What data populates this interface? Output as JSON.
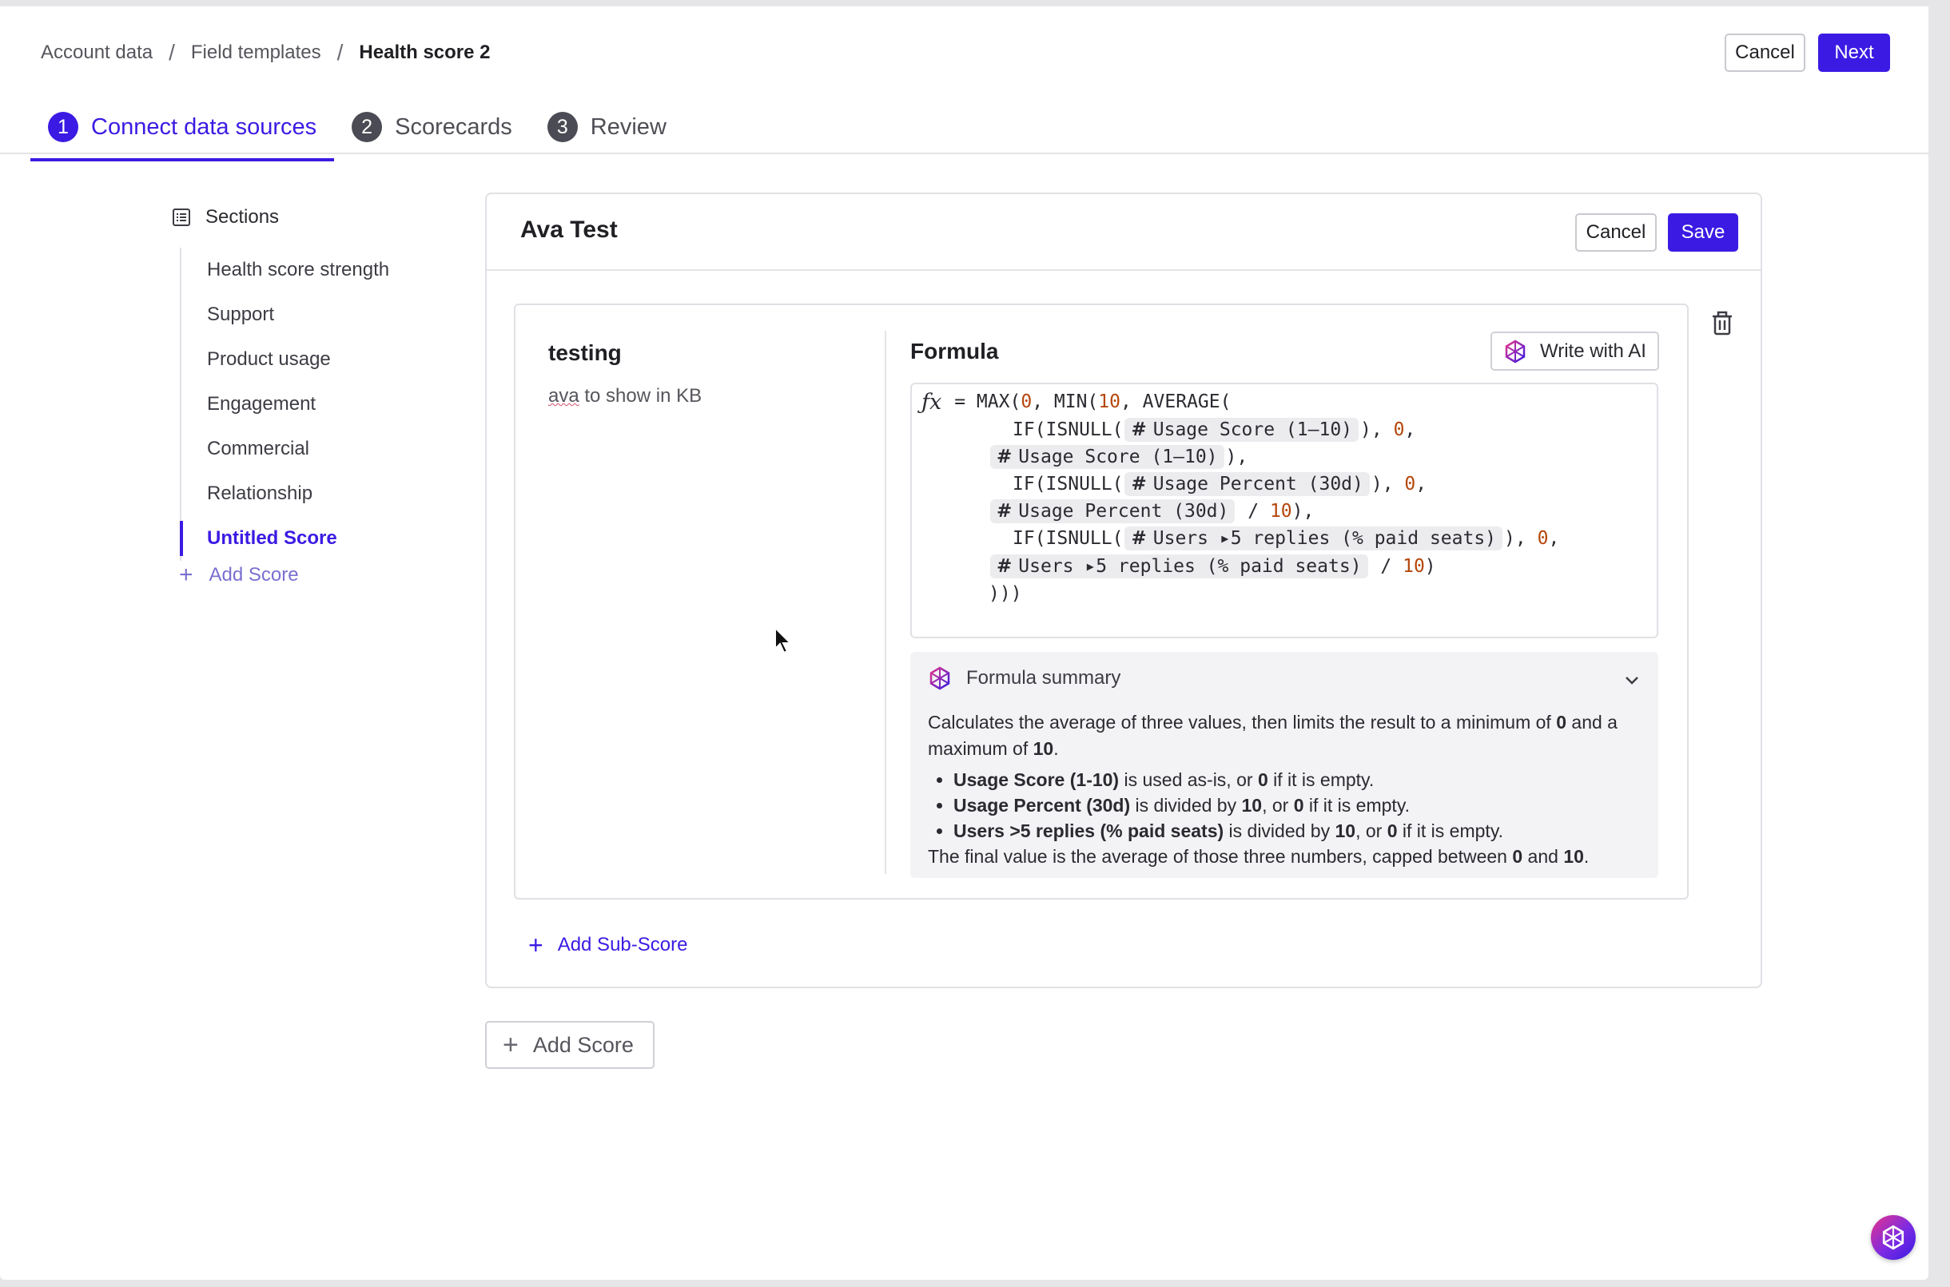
{
  "breadcrumb": {
    "items": [
      "Account data",
      "Field templates"
    ],
    "current": "Health score 2",
    "separator": "/"
  },
  "header": {
    "cancel_label": "Cancel",
    "next_label": "Next"
  },
  "steps": [
    {
      "number": "1",
      "label": "Connect data sources",
      "active": true
    },
    {
      "number": "2",
      "label": "Scorecards",
      "active": false
    },
    {
      "number": "3",
      "label": "Review",
      "active": false
    }
  ],
  "sidebar": {
    "title": "Sections",
    "items": [
      {
        "label": "Health score strength"
      },
      {
        "label": "Support"
      },
      {
        "label": "Product usage"
      },
      {
        "label": "Engagement"
      },
      {
        "label": "Commercial"
      },
      {
        "label": "Relationship"
      },
      {
        "label": "Untitled Score",
        "active": true
      }
    ],
    "add_label": "Add Score"
  },
  "card": {
    "title": "Ava Test",
    "cancel_label": "Cancel",
    "save_label": "Save",
    "subscore": {
      "name": "testing",
      "desc_word": "ava",
      "desc_rest": " to show in KB",
      "formula_label": "Formula",
      "ai_button_label": "Write with AI",
      "formula": {
        "fx": "ƒx",
        "l1_a": "= MAX(",
        "l1_n1": "0",
        "l1_b": ", MIN(",
        "l1_n2": "10",
        "l1_c": ", AVERAGE(",
        "l2_a": "IF(ISNULL(",
        "field1": "Usage Score (1–10)",
        "l2_b": "), ",
        "l2_n": "0",
        "l2_c": ",",
        "l3_b": "),",
        "l4_a": "IF(ISNULL(",
        "field2": "Usage Percent (30d)",
        "l4_b": "), ",
        "l4_n": "0",
        "l4_c": ",",
        "l5_b": " / ",
        "l5_n": "10",
        "l5_c": "),",
        "l6_a": "IF(ISNULL(",
        "field3": "Users ▸5 replies (% paid seats)",
        "l6_b": "), ",
        "l6_n": "0",
        "l6_c": ",",
        "l7_b": " / ",
        "l7_n": "10",
        "l7_c": ")",
        "l8": ")))"
      },
      "summary": {
        "title": "Formula summary",
        "intro_a": "Calculates the average of three values, then limits the result to a minimum of ",
        "intro_min": "0",
        "intro_b": " and a maximum of ",
        "intro_max": "10",
        "intro_c": ".",
        "b1_field": "Usage Score (1-10)",
        "b1_a": " is used as-is, or ",
        "b1_zero": "0",
        "b1_b": " if it is empty.",
        "b2_field": "Usage Percent (30d)",
        "b2_a": " is divided by ",
        "b2_ten": "10",
        "b2_b": ", or ",
        "b2_zero": "0",
        "b2_c": " if it is empty.",
        "b3_field": "Users >5 replies (% paid seats)",
        "b3_a": " is divided by ",
        "b3_ten": "10",
        "b3_b": ", or ",
        "b3_zero": "0",
        "b3_c": " if it is empty.",
        "final_a": "The final value is the average of those three numbers, capped between ",
        "final_min": "0",
        "final_b": " and ",
        "final_max": "10",
        "final_c": "."
      }
    },
    "add_subscore_label": "Add Sub-Score"
  },
  "add_score_label": "Add Score",
  "colors": {
    "accent": "#3b1be3",
    "number_token": "#b5460b",
    "chip_bg": "#ececef"
  },
  "icons": [
    "sections-list-icon",
    "plus-icon",
    "ai-hexagon-icon",
    "chevron-down-icon",
    "trash-icon",
    "assistant-fab-icon",
    "mouse-cursor-icon"
  ]
}
